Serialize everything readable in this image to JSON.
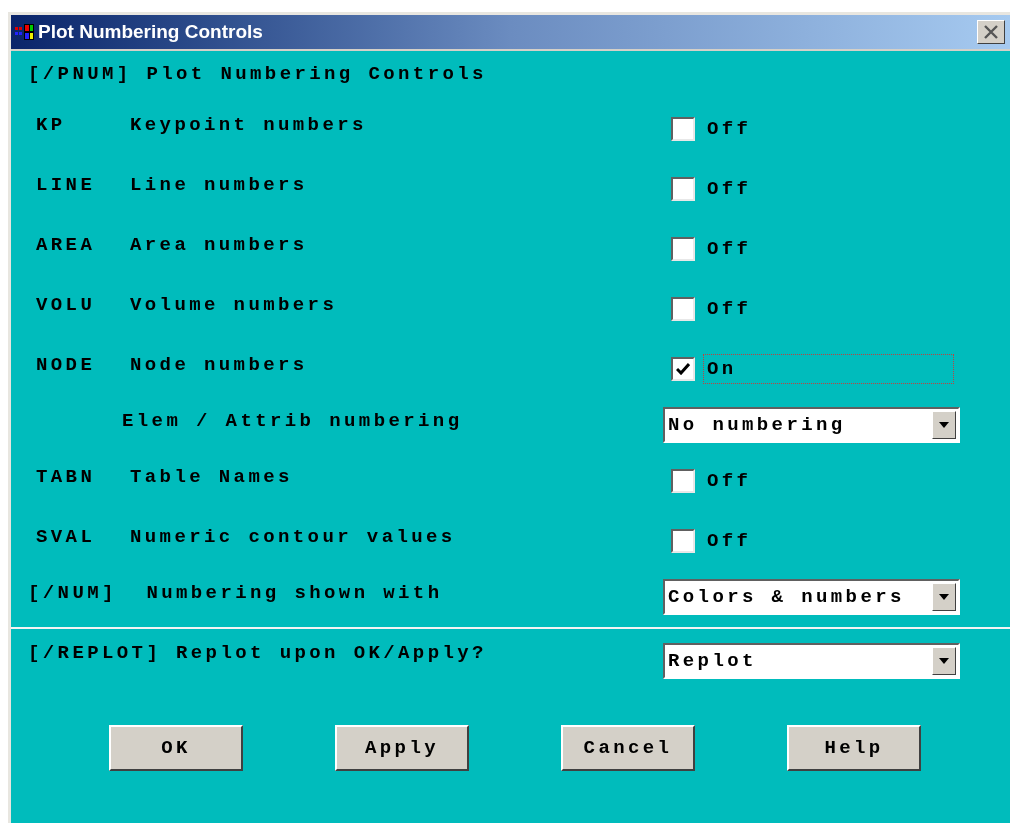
{
  "window": {
    "title": "Plot Numbering Controls"
  },
  "heading": "[/PNUM]  Plot Numbering Controls",
  "rows": [
    {
      "kind": "checkbox",
      "code": "KP",
      "label": "Keypoint numbers",
      "checked": false,
      "focused": false,
      "value": "Off"
    },
    {
      "kind": "checkbox",
      "code": "LINE",
      "label": "Line numbers",
      "checked": false,
      "focused": false,
      "value": "Off"
    },
    {
      "kind": "checkbox",
      "code": "AREA",
      "label": "Area numbers",
      "checked": false,
      "focused": false,
      "value": "Off"
    },
    {
      "kind": "checkbox",
      "code": "VOLU",
      "label": "Volume numbers",
      "checked": false,
      "focused": false,
      "value": "Off"
    },
    {
      "kind": "checkbox",
      "code": "NODE",
      "label": "Node numbers",
      "checked": true,
      "focused": true,
      "value": "On"
    },
    {
      "kind": "dropdown",
      "label": "Elem / Attrib numbering",
      "value": "No numbering"
    },
    {
      "kind": "checkbox",
      "code": "TABN",
      "label": "Table Names",
      "checked": false,
      "focused": false,
      "value": "Off"
    },
    {
      "kind": "checkbox",
      "code": "SVAL",
      "label": "Numeric contour values",
      "checked": false,
      "focused": false,
      "value": "Off"
    },
    {
      "kind": "dropdown",
      "label": "[/NUM]  Numbering shown with",
      "value": "Colors & numbers"
    }
  ],
  "replot": {
    "label": "[/REPLOT] Replot upon OK/Apply?",
    "value": "Replot"
  },
  "buttons": [
    "OK",
    "Apply",
    "Cancel",
    "Help"
  ]
}
